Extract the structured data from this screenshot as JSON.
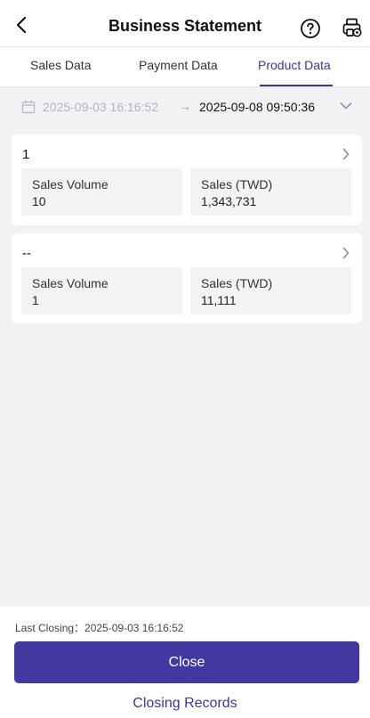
{
  "header": {
    "title": "Business Statement"
  },
  "tabs": [
    {
      "label": "Sales Data",
      "active": false
    },
    {
      "label": "Payment Data",
      "active": false
    },
    {
      "label": "Product Data",
      "active": true
    }
  ],
  "date_range": {
    "start": "2025-09-03 16:16:52",
    "arrow": "→",
    "end": "2025-09-08 09:50:36"
  },
  "cards": [
    {
      "title": "1",
      "stats": [
        {
          "label": "Sales Volume",
          "value": "10"
        },
        {
          "label": "Sales (TWD)",
          "value": "1,343,731"
        }
      ]
    },
    {
      "title": "--",
      "stats": [
        {
          "label": "Sales Volume",
          "value": "1"
        },
        {
          "label": "Sales (TWD)",
          "value": "11,111"
        }
      ]
    }
  ],
  "footer": {
    "last_closing": "Last Closing：2025-09-03 16:16:52",
    "close_label": "Close",
    "records_label": "Closing Records"
  },
  "colors": {
    "accent": "#43389f",
    "tab_active": "#3f34a0",
    "background": "#f2f2f4"
  },
  "icons": {
    "back": "chevron-left-icon",
    "help": "question-circle-icon",
    "print": "printer-settings-icon",
    "calendar": "calendar-icon",
    "dropdown": "chevron-down-icon",
    "card_nav": "chevron-right-icon"
  }
}
